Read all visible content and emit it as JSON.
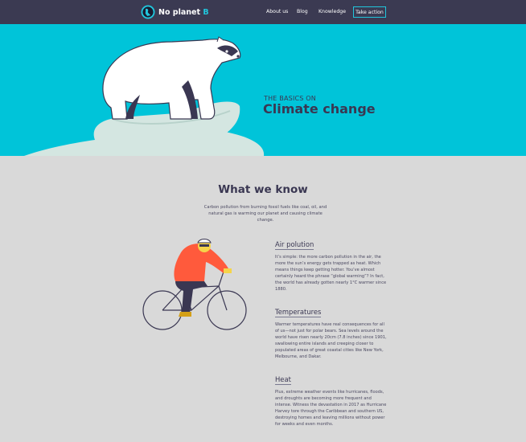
{
  "brand": {
    "name": "No planet",
    "accent": "B",
    "accent_color": "#21c6dc"
  },
  "nav": {
    "links": [
      "About us",
      "Blog",
      "Knowledge"
    ],
    "cta": "Take action"
  },
  "hero": {
    "kicker": "THE BASICS ON",
    "title": "Climate change",
    "background": "#00c4d9"
  },
  "what_we_know": {
    "title": "What we know",
    "intro": "Carbon pollution from burning fossil fuels like coal, oil, and natural gas is warming our planet and causing climate change."
  },
  "topics": [
    {
      "title": "Air polution",
      "body": "It’s simple: the more carbon pollution in the air, the more the sun’s energy gets trapped as heat. Which means things keep getting hotter. You’ve almost certainly heard the phrase “global warming”? In fact, the world has already gotten nearly 1°C warmer since 1880."
    },
    {
      "title": "Temperatures",
      "body": "Warmer temperatures have real consequences for all of us—not just for polar bears. Sea levels around the world have risen nearly 20cm (7.8 inches) since 1901, swallowing entire islands and creeping closer to populated areas of great coastal cities like New York, Melbourne, and Dakar."
    },
    {
      "title": "Heat",
      "body": "Plus, extreme weather events like hurricanes, floods, and droughts are becoming more frequent and intense. Witness the devastation in 2017 as Hurricane Harvey tore through the Caribbean and southern US, destroying homes and leaving millions without power for weeks and even months."
    }
  ],
  "colors": {
    "nav_bg": "#3b3a52",
    "page_bg": "#d9d9d9",
    "text": "#3a3752",
    "jacket": "#ff5a3c"
  }
}
